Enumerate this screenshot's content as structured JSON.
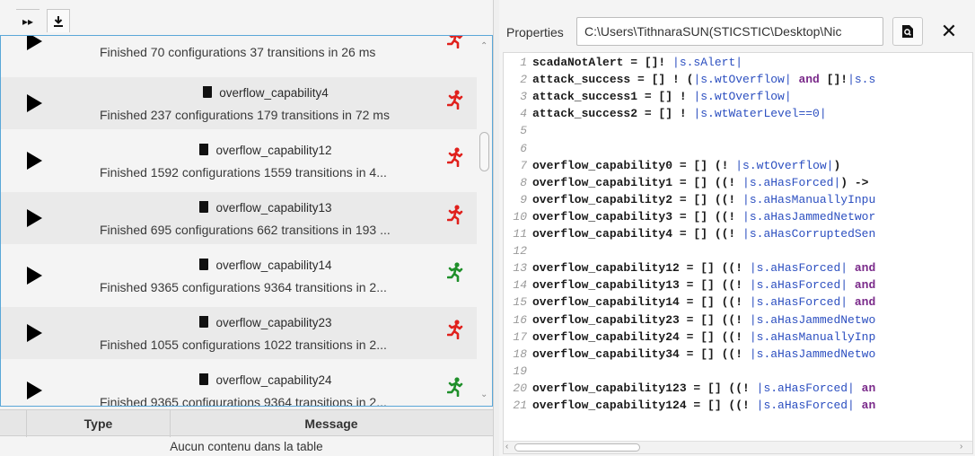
{
  "toolbar": {
    "run_all_icon": "fast-forward-icon",
    "download_icon": "download-icon"
  },
  "rows": [
    {
      "name": "",
      "message": "Finished 70 configurations 37 transitions in 26 ms",
      "status": "red"
    },
    {
      "name": "overflow_capability4",
      "message": "Finished 237 configurations 179 transitions in 72 ms",
      "status": "red"
    },
    {
      "name": "overflow_capability12",
      "message": "Finished 1592 configurations 1559 transitions in 4...",
      "status": "red"
    },
    {
      "name": "overflow_capability13",
      "message": "Finished 695 configurations 662 transitions in 193 ...",
      "status": "red"
    },
    {
      "name": "overflow_capability14",
      "message": "Finished 9365 configurations 9364 transitions in 2...",
      "status": "green"
    },
    {
      "name": "overflow_capability23",
      "message": "Finished 1055 configurations 1022 transitions in 2...",
      "status": "red"
    },
    {
      "name": "overflow_capability24",
      "message": "Finished 9365 configurations 9364 transitions in 2...",
      "status": "green"
    }
  ],
  "status_colors": {
    "red": "#e0201c",
    "green": "#1f8f2a"
  },
  "table": {
    "col_type": "Type",
    "col_message": "Message",
    "empty": "Aucun contenu dans la table"
  },
  "properties": {
    "label": "Properties",
    "path": "C:\\Users\\TithnaraSUN(STICSTIC\\Desktop\\Nic",
    "search_icon": "document-search-icon",
    "close_label": "✕"
  },
  "editor_lines": [
    {
      "n": "1",
      "segs": [
        [
          "c",
          "scadaNotAlert = []! "
        ],
        [
          "p",
          "|s.sAlert|"
        ]
      ]
    },
    {
      "n": "2",
      "segs": [
        [
          "c",
          "attack_success = [] ! ("
        ],
        [
          "p",
          "|s.wtOverflow|"
        ],
        [
          "k",
          " and "
        ],
        [
          "c",
          "[]!"
        ],
        [
          "p",
          "|s.s"
        ]
      ]
    },
    {
      "n": "3",
      "segs": [
        [
          "c",
          "attack_success1 = [] ! "
        ],
        [
          "p",
          "|s.wtOverflow|"
        ]
      ]
    },
    {
      "n": "4",
      "segs": [
        [
          "c",
          "attack_success2 = [] ! "
        ],
        [
          "p",
          "|s.wtWaterLevel==0|"
        ]
      ]
    },
    {
      "n": "5",
      "segs": []
    },
    {
      "n": "6",
      "segs": []
    },
    {
      "n": "7",
      "segs": [
        [
          "c",
          "overflow_capability0 = [] (! "
        ],
        [
          "p",
          "|s.wtOverflow|"
        ],
        [
          "c",
          ")"
        ]
      ]
    },
    {
      "n": "8",
      "segs": [
        [
          "c",
          "overflow_capability1 = [] ((! "
        ],
        [
          "p",
          "|s.aHasForced|"
        ],
        [
          "c",
          ") ->"
        ]
      ]
    },
    {
      "n": "9",
      "segs": [
        [
          "c",
          "overflow_capability2 = [] ((! "
        ],
        [
          "p",
          "|s.aHasManuallyInpu"
        ]
      ]
    },
    {
      "n": "10",
      "segs": [
        [
          "c",
          "overflow_capability3 = [] ((! "
        ],
        [
          "p",
          "|s.aHasJammedNetwor"
        ]
      ]
    },
    {
      "n": "11",
      "segs": [
        [
          "c",
          "overflow_capability4 = [] ((! "
        ],
        [
          "p",
          "|s.aHasCorruptedSen"
        ]
      ]
    },
    {
      "n": "12",
      "segs": []
    },
    {
      "n": "13",
      "segs": [
        [
          "c",
          "overflow_capability12 = [] ((! "
        ],
        [
          "p",
          "|s.aHasForced|"
        ],
        [
          "k",
          " and"
        ]
      ]
    },
    {
      "n": "14",
      "segs": [
        [
          "c",
          "overflow_capability13 = [] ((! "
        ],
        [
          "p",
          "|s.aHasForced|"
        ],
        [
          "k",
          " and"
        ]
      ]
    },
    {
      "n": "15",
      "segs": [
        [
          "c",
          "overflow_capability14 = [] ((! "
        ],
        [
          "p",
          "|s.aHasForced|"
        ],
        [
          "k",
          " and"
        ]
      ]
    },
    {
      "n": "16",
      "segs": [
        [
          "c",
          "overflow_capability23 = [] ((! "
        ],
        [
          "p",
          "|s.aHasJammedNetwo"
        ]
      ]
    },
    {
      "n": "17",
      "segs": [
        [
          "c",
          "overflow_capability24 = [] ((! "
        ],
        [
          "p",
          "|s.aHasManuallyInp"
        ]
      ]
    },
    {
      "n": "18",
      "segs": [
        [
          "c",
          "overflow_capability34 = [] ((! "
        ],
        [
          "p",
          "|s.aHasJammedNetwo"
        ]
      ]
    },
    {
      "n": "19",
      "segs": []
    },
    {
      "n": "20",
      "segs": [
        [
          "c",
          "overflow_capability123 = [] ((! "
        ],
        [
          "p",
          "|s.aHasForced|"
        ],
        [
          "k",
          " an"
        ]
      ]
    },
    {
      "n": "21",
      "segs": [
        [
          "c",
          "overflow_capability124 = [] ((! "
        ],
        [
          "p",
          "|s.aHasForced|"
        ],
        [
          "k",
          " an"
        ]
      ]
    }
  ]
}
